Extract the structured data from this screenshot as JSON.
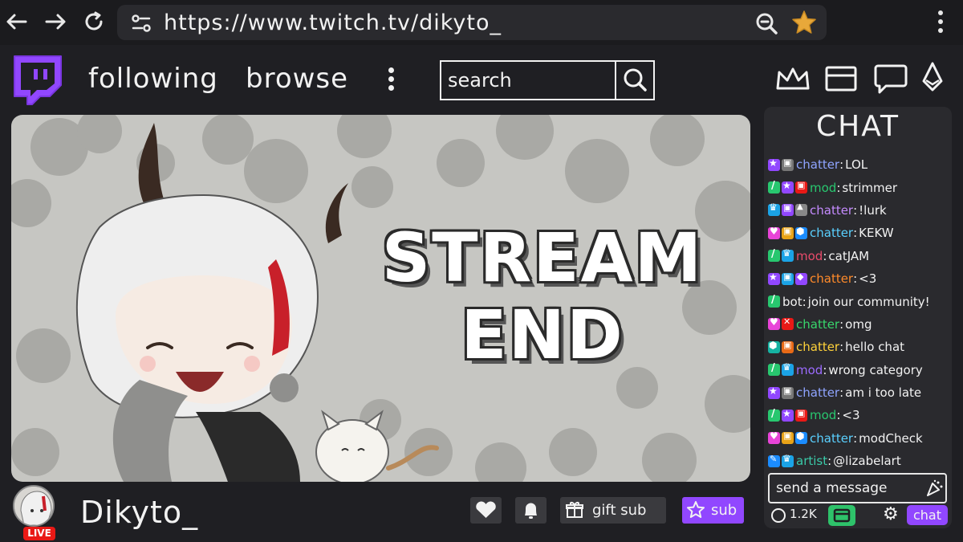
{
  "browser": {
    "url": "https://www.twitch.tv/dikyto_",
    "icons": [
      "back-arrow-icon",
      "forward-arrow-icon",
      "reload-icon",
      "site-settings-icon",
      "zoom-out-icon",
      "bookmark-star-icon",
      "browser-menu-icon"
    ]
  },
  "header": {
    "nav_following": "following",
    "nav_browse": "browse",
    "search_placeholder": "search",
    "right_icons": [
      "crown-icon",
      "inbox-icon",
      "whispers-icon",
      "bits-icon"
    ]
  },
  "stream": {
    "end_line1": "STREAM",
    "end_line2": "END"
  },
  "chat": {
    "title": "CHAT",
    "messages": [
      {
        "user": "chatter",
        "text": "LOL",
        "user_color": "#8fa4ff",
        "badges": [
          {
            "icon": "star",
            "color": "#9147ff"
          },
          {
            "icon": "gift",
            "color": "#777"
          }
        ]
      },
      {
        "user": "mod",
        "text": "strimmer",
        "user_color": "#28c76f",
        "badges": [
          {
            "icon": "sword",
            "color": "#28c76f"
          },
          {
            "icon": "star",
            "color": "#9147ff"
          },
          {
            "icon": "gift",
            "color": "#e91916"
          }
        ]
      },
      {
        "user": "chatter",
        "text": "!lurk",
        "user_color": "#c58bff",
        "badges": [
          {
            "icon": "crown",
            "color": "#1ba3e6"
          },
          {
            "icon": "gift",
            "color": "#9147ff"
          },
          {
            "icon": "tri",
            "color": "#888"
          }
        ]
      },
      {
        "user": "chatter",
        "text": "KEKW",
        "user_color": "#5ad0ff",
        "badges": [
          {
            "icon": "heart",
            "color": "#e844d8"
          },
          {
            "icon": "gift",
            "color": "#e8a317"
          },
          {
            "icon": "hex",
            "color": "#1b8cff"
          }
        ]
      },
      {
        "user": "mod",
        "text": "catJAM",
        "user_color": "#e94b6b",
        "badges": [
          {
            "icon": "sword",
            "color": "#28c76f"
          },
          {
            "icon": "crown",
            "color": "#1ba3e6"
          }
        ]
      },
      {
        "user": "chatter",
        "text": "<3",
        "user_color": "#ff8a2a",
        "badges": [
          {
            "icon": "star",
            "color": "#9147ff"
          },
          {
            "icon": "gift",
            "color": "#1ba3e6"
          },
          {
            "icon": "gem",
            "color": "#9147ff"
          }
        ]
      },
      {
        "user": "bot",
        "text": "join our community!",
        "user_color": "#f2f2f2",
        "badges": [
          {
            "icon": "sword",
            "color": "#28c76f"
          }
        ]
      },
      {
        "user": "chatter",
        "text": "omg",
        "user_color": "#38d66b",
        "badges": [
          {
            "icon": "heart",
            "color": "#e844d8"
          },
          {
            "icon": "x",
            "color": "#e91916"
          }
        ]
      },
      {
        "user": "chatter",
        "text": "hello chat",
        "user_color": "#ffd23a",
        "badges": [
          {
            "icon": "hex",
            "color": "#16b3a3"
          },
          {
            "icon": "gift",
            "color": "#e86a17"
          }
        ]
      },
      {
        "user": "mod",
        "text": "wrong category",
        "user_color": "#9b6bff",
        "badges": [
          {
            "icon": "sword",
            "color": "#28c76f"
          },
          {
            "icon": "crown",
            "color": "#1ba3e6"
          }
        ]
      },
      {
        "user": "chatter",
        "text": "am i too late",
        "user_color": "#8fa4ff",
        "badges": [
          {
            "icon": "star",
            "color": "#9147ff"
          },
          {
            "icon": "gift",
            "color": "#777"
          }
        ]
      },
      {
        "user": "mod",
        "text": "<3",
        "user_color": "#28c76f",
        "badges": [
          {
            "icon": "sword",
            "color": "#28c76f"
          },
          {
            "icon": "star",
            "color": "#9147ff"
          },
          {
            "icon": "gift",
            "color": "#e91916"
          }
        ]
      },
      {
        "user": "chatter",
        "text": "modCheck",
        "user_color": "#5ad0ff",
        "badges": [
          {
            "icon": "heart",
            "color": "#e844d8"
          },
          {
            "icon": "gift",
            "color": "#e8a317"
          },
          {
            "icon": "hex",
            "color": "#1b8cff"
          }
        ]
      },
      {
        "user": "artist",
        "text": "@lizabelart",
        "user_color": "#3ac9a8",
        "badges": [
          {
            "icon": "pen",
            "color": "#1b8cff"
          },
          {
            "icon": "crown",
            "color": "#1ba3e6"
          }
        ]
      }
    ],
    "input_placeholder": "send a message",
    "viewer_count": "1.2K",
    "chat_button": "chat"
  },
  "channel": {
    "name": "Dikyto_",
    "live_label": "LIVE",
    "gift_sub_label": "gift sub",
    "sub_label": "sub"
  },
  "colors": {
    "accent": "#9147ff",
    "live": "#e91916",
    "background": "#1f1f23"
  }
}
